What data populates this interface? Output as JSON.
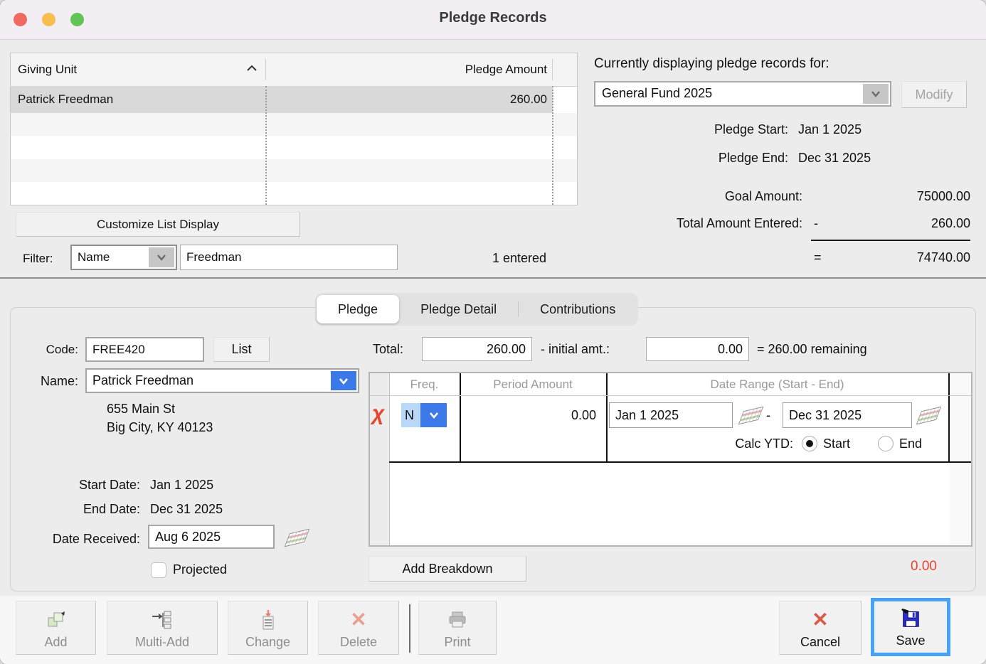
{
  "window": {
    "title": "Pledge Records"
  },
  "giving_list": {
    "header": {
      "name_col": "Giving Unit",
      "amount_col": "Pledge Amount"
    },
    "rows": [
      {
        "name": "Patrick Freedman",
        "amount": "260.00"
      }
    ],
    "customize_button": "Customize List Display",
    "filter_label": "Filter:",
    "filter_field": "Name",
    "filter_value": "Freedman",
    "entered_count": "1 entered"
  },
  "fund_panel": {
    "heading": "Currently displaying pledge records for:",
    "fund_name": "General Fund 2025",
    "modify_button": "Modify",
    "pledge_start_label": "Pledge Start:",
    "pledge_start_value": "Jan 1 2025",
    "pledge_end_label": "Pledge End:",
    "pledge_end_value": "Dec 31 2025",
    "goal_label": "Goal Amount:",
    "goal_value": "75000.00",
    "entered_label": "Total Amount Entered:",
    "minus_sign": "-",
    "entered_value": "260.00",
    "equals_sign": "=",
    "remaining_value": "74740.00"
  },
  "tabs": [
    {
      "label": "Pledge"
    },
    {
      "label": "Pledge Detail"
    },
    {
      "label": "Contributions"
    }
  ],
  "pledge_form": {
    "code_label": "Code:",
    "code_value": "FREE420",
    "list_button": "List",
    "name_label": "Name:",
    "name_value": "Patrick Freedman",
    "address_line1": "655 Main St",
    "address_line2": "Big City, KY 40123",
    "start_date_label": "Start Date:",
    "start_date_value": "Jan 1 2025",
    "end_date_label": "End Date:",
    "end_date_value": "Dec 31 2025",
    "date_received_label": "Date Received:",
    "date_received_value": "Aug 6 2025",
    "projected_label": "Projected",
    "total_label": "Total:",
    "total_value": "260.00",
    "initial_label": "- initial amt.:",
    "initial_value": "0.00",
    "remaining_text": "= 260.00 remaining"
  },
  "breakdown": {
    "headers": {
      "freq": "Freq.",
      "period_amount": "Period Amount",
      "date_range": "Date Range (Start - End)"
    },
    "row": {
      "freq_value": "N",
      "period_amount_value": "0.00",
      "date_start_value": "Jan 1 2025",
      "range_dash": "-",
      "date_end_value": "Dec 31 2025"
    },
    "calc_ytd_label": "Calc YTD:",
    "calc_start_label": "Start",
    "calc_end_label": "End",
    "add_button": "Add Breakdown",
    "total_amount": "0.00"
  },
  "toolbar": {
    "add": "Add",
    "multi_add": "Multi-Add",
    "change": "Change",
    "delete": "Delete",
    "print": "Print",
    "cancel": "Cancel",
    "save": "Save"
  }
}
